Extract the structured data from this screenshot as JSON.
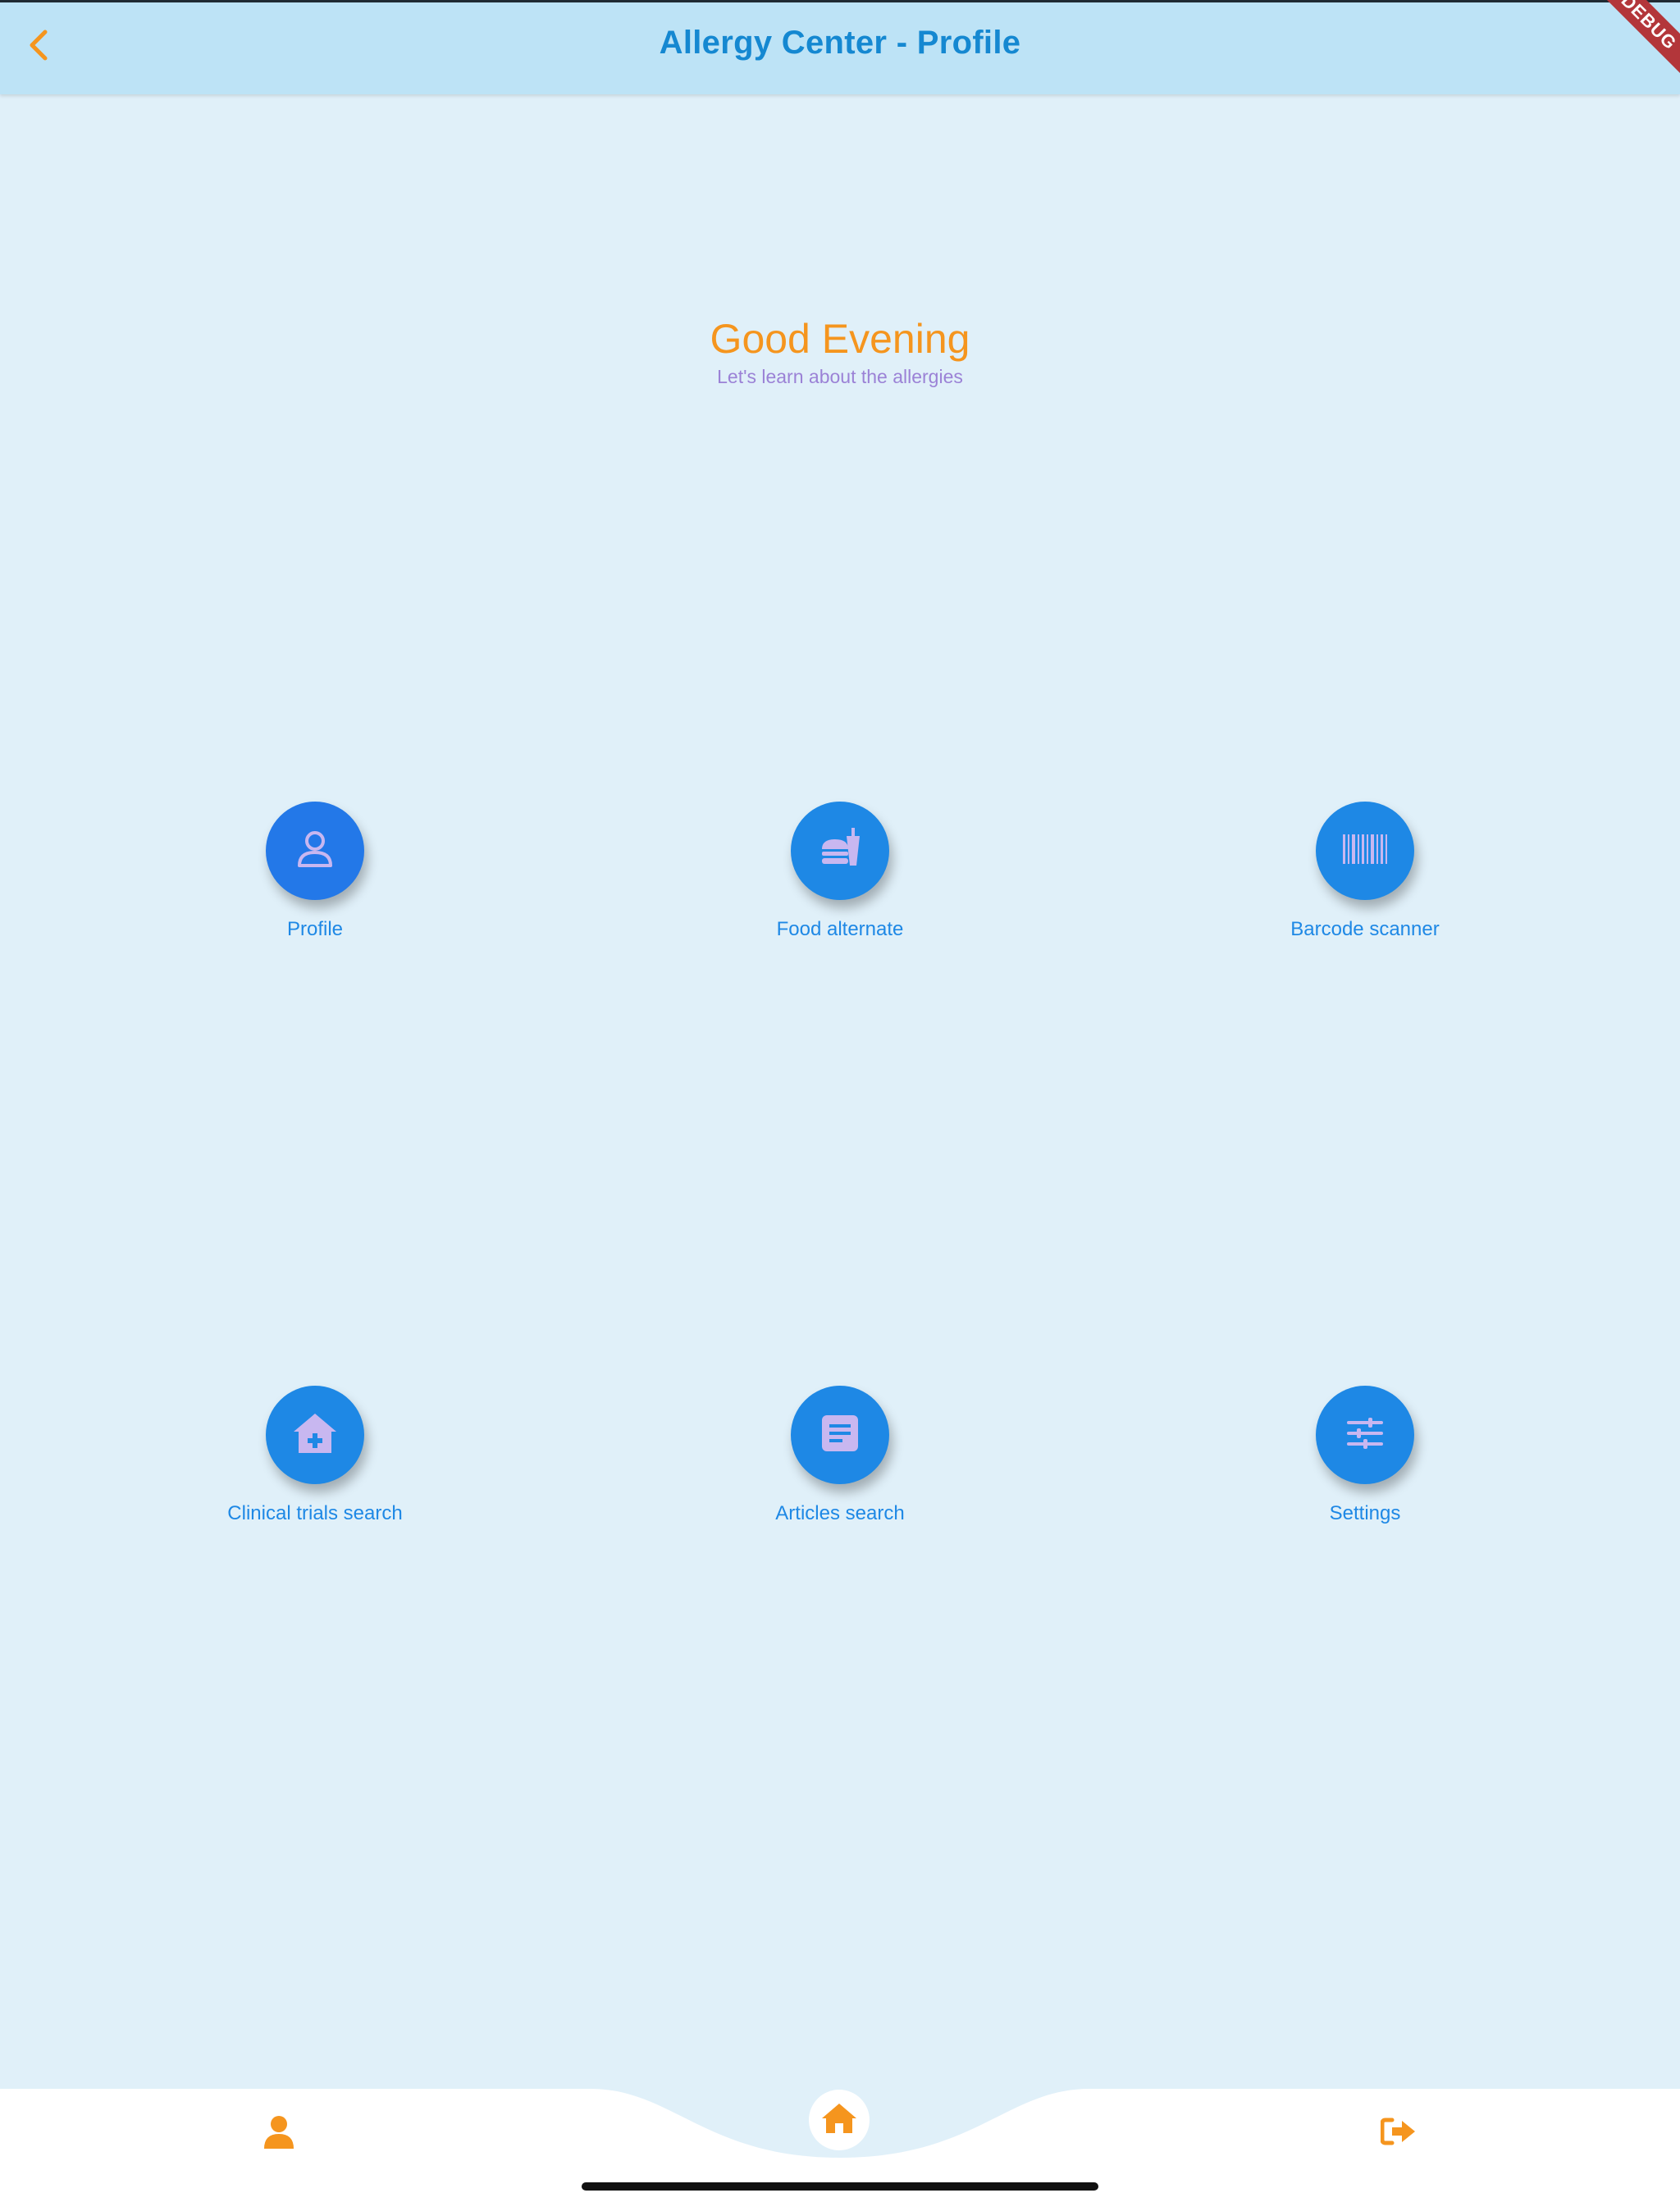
{
  "appbar": {
    "title": "Allergy Center - Profile",
    "back_icon": "chevron-left-icon"
  },
  "debug_banner": "DEBUG",
  "greeting": {
    "title": "Good Evening",
    "subtitle": "Let's learn about the allergies"
  },
  "tiles": [
    {
      "label": "Profile",
      "icon": "user-icon"
    },
    {
      "label": "Food alternate",
      "icon": "fastfood-icon"
    },
    {
      "label": "Barcode scanner",
      "icon": "barcode-icon"
    },
    {
      "label": "Clinical trials search",
      "icon": "hospital-icon"
    },
    {
      "label": "Articles search",
      "icon": "article-icon"
    },
    {
      "label": "Settings",
      "icon": "sliders-icon"
    }
  ],
  "bottom_nav": {
    "items": [
      {
        "icon": "person-icon"
      },
      {
        "icon": "home-icon"
      },
      {
        "icon": "sign-out-icon"
      }
    ]
  },
  "colors": {
    "background": "#e0f0f9",
    "appbar": "#bde3f6",
    "accent_orange": "#f5951e",
    "primary_blue": "#1e88e5",
    "title_blue": "#1588d1",
    "subtitle_purple": "#9b82d6",
    "icon_lavender": "#c8b7f0"
  }
}
